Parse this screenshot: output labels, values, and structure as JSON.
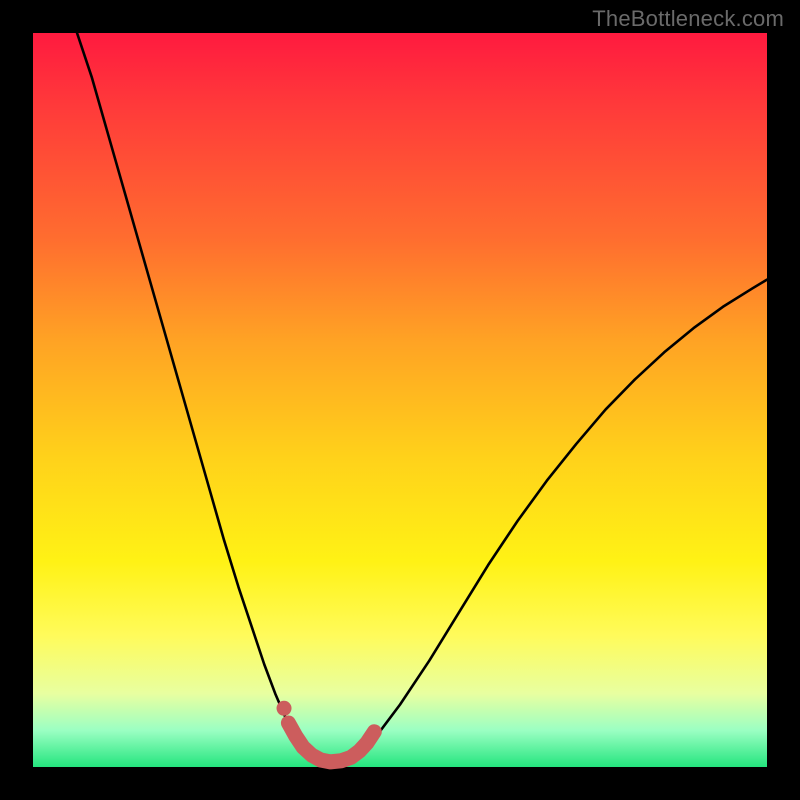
{
  "watermark": "TheBottleneck.com",
  "colors": {
    "frame": "#000000",
    "curve_stroke": "#000000",
    "marker_stroke": "#cc5d5d",
    "marker_fill_dot": "#cc5d5d",
    "gradient_top": "#ff1a3f",
    "gradient_bottom": "#24e57e"
  },
  "chart_data": {
    "type": "line",
    "title": "",
    "xlabel": "",
    "ylabel": "",
    "xlim": [
      0,
      100
    ],
    "ylim": [
      0,
      100
    ],
    "grid": false,
    "curve_xy_pct": [
      [
        6,
        100
      ],
      [
        8,
        94
      ],
      [
        10,
        87
      ],
      [
        12,
        80
      ],
      [
        14,
        73
      ],
      [
        16,
        66
      ],
      [
        18,
        59
      ],
      [
        20,
        52
      ],
      [
        22,
        45
      ],
      [
        24,
        38
      ],
      [
        26,
        31
      ],
      [
        28,
        24.5
      ],
      [
        30,
        18.5
      ],
      [
        31.5,
        14
      ],
      [
        33,
        10
      ],
      [
        34.5,
        6.5
      ],
      [
        36,
        4
      ],
      [
        37.5,
        2
      ],
      [
        39,
        1
      ],
      [
        41,
        0.7
      ],
      [
        43,
        1.1
      ],
      [
        45,
        2.3
      ],
      [
        47,
        4.5
      ],
      [
        50,
        8.5
      ],
      [
        54,
        14.5
      ],
      [
        58,
        21
      ],
      [
        62,
        27.5
      ],
      [
        66,
        33.5
      ],
      [
        70,
        39
      ],
      [
        74,
        44
      ],
      [
        78,
        48.7
      ],
      [
        82,
        52.8
      ],
      [
        86,
        56.5
      ],
      [
        90,
        59.8
      ],
      [
        94,
        62.7
      ],
      [
        98,
        65.2
      ],
      [
        100,
        66.4
      ]
    ],
    "thick_segment_xy_pct": [
      [
        34.8,
        6.0
      ],
      [
        35.8,
        4.2
      ],
      [
        36.8,
        2.7
      ],
      [
        38.0,
        1.6
      ],
      [
        39.2,
        0.95
      ],
      [
        40.5,
        0.7
      ],
      [
        42.0,
        0.85
      ],
      [
        43.3,
        1.3
      ],
      [
        44.5,
        2.2
      ],
      [
        45.5,
        3.3
      ],
      [
        46.5,
        4.8
      ]
    ],
    "marker_dot_xy_pct": [
      34.2,
      8.0
    ]
  }
}
